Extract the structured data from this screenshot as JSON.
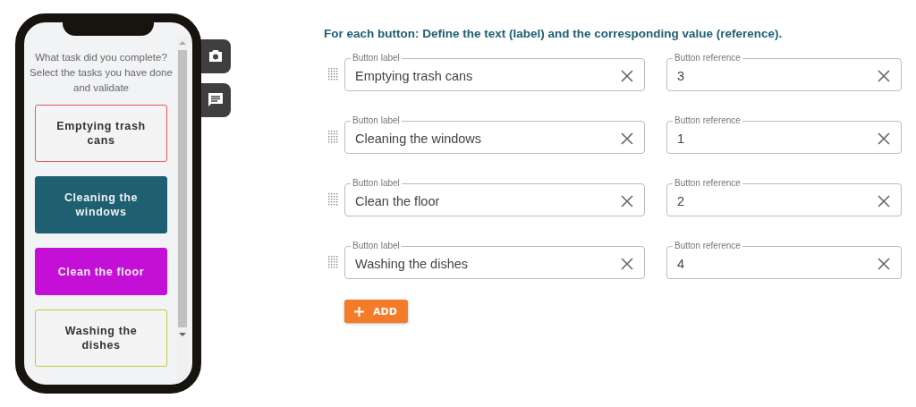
{
  "phone": {
    "question": "What task did you complete? Select the tasks you have done and validate",
    "tasks": [
      {
        "label": "Emptying trash cans",
        "kind": "outlined",
        "color": "#e05a5a"
      },
      {
        "label": "Cleaning the windows",
        "kind": "filled",
        "color": "#1e5f72"
      },
      {
        "label": "Clean the floor",
        "kind": "filled",
        "color": "#c410d6"
      },
      {
        "label": "Washing the dishes",
        "kind": "outlined",
        "color": "#c8c83a"
      }
    ]
  },
  "editor": {
    "heading": "For each button: Define the text (label) and the corresponding value (reference).",
    "rows": [
      {
        "label_caption": "Button label",
        "label": "Emptying trash cans",
        "reference_caption": "Button reference",
        "reference": "3"
      },
      {
        "label_caption": "Button label",
        "label": "Cleaning the windows",
        "reference_caption": "Button reference",
        "reference": "1"
      },
      {
        "label_caption": "Button label",
        "label": "Clean the floor",
        "reference_caption": "Button reference",
        "reference": "2"
      },
      {
        "label_caption": "Button label",
        "label": "Washing the dishes",
        "reference_caption": "Button reference",
        "reference": "4"
      }
    ],
    "add_button": "ADD"
  }
}
